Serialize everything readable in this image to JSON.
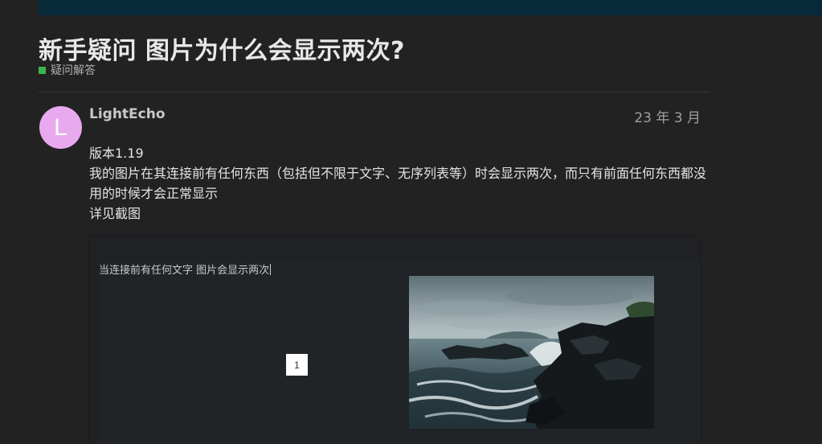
{
  "topic": {
    "title": "新手疑问 图片为什么会显示两次?",
    "category": {
      "label": "疑问解答",
      "color": "#3ab54a"
    }
  },
  "post": {
    "author": {
      "initial": "L",
      "name": "LightEcho",
      "avatar_color": "#e9a9ef"
    },
    "date": "23 年 3 月",
    "body": [
      "版本1.19",
      "我的图片在其连接前有任何东西（包括但不限于文字、无序列表等）时会显示两次，而只有前面任何东西都没用的时候才会正常显示",
      "详见截图"
    ],
    "screenshot": {
      "caption": "当连接前有任何文字 图片会显示两次",
      "badge": "1",
      "photo": "seascape-photo"
    }
  }
}
